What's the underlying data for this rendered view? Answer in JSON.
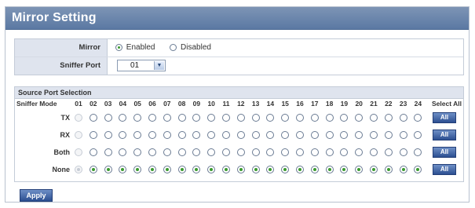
{
  "title": "Mirror Setting",
  "mirror": {
    "label": "Mirror",
    "options": [
      "Enabled",
      "Disabled"
    ],
    "selected": "Enabled"
  },
  "sniffer_port": {
    "label": "Sniffer Port",
    "value": "01"
  },
  "source_port_selection": {
    "title": "Source Port Selection",
    "mode_header": "Sniffer Mode",
    "ports": [
      "01",
      "02",
      "03",
      "04",
      "05",
      "06",
      "07",
      "08",
      "09",
      "10",
      "11",
      "12",
      "13",
      "14",
      "15",
      "16",
      "17",
      "18",
      "19",
      "20",
      "21",
      "22",
      "23",
      "24"
    ],
    "select_all_header": "Select All",
    "rows": [
      {
        "label": "TX",
        "button": "All"
      },
      {
        "label": "RX",
        "button": "All"
      },
      {
        "label": "Both",
        "button": "All"
      },
      {
        "label": "None",
        "button": "All"
      }
    ],
    "selected_row": "None",
    "disabled_port": "01"
  },
  "apply_button": "Apply",
  "colors": {
    "title_bar": "#6a85ad",
    "label_bg": "#dfe4ee",
    "button": "#2c4f91",
    "radio_selected": "#3a9a2e"
  }
}
